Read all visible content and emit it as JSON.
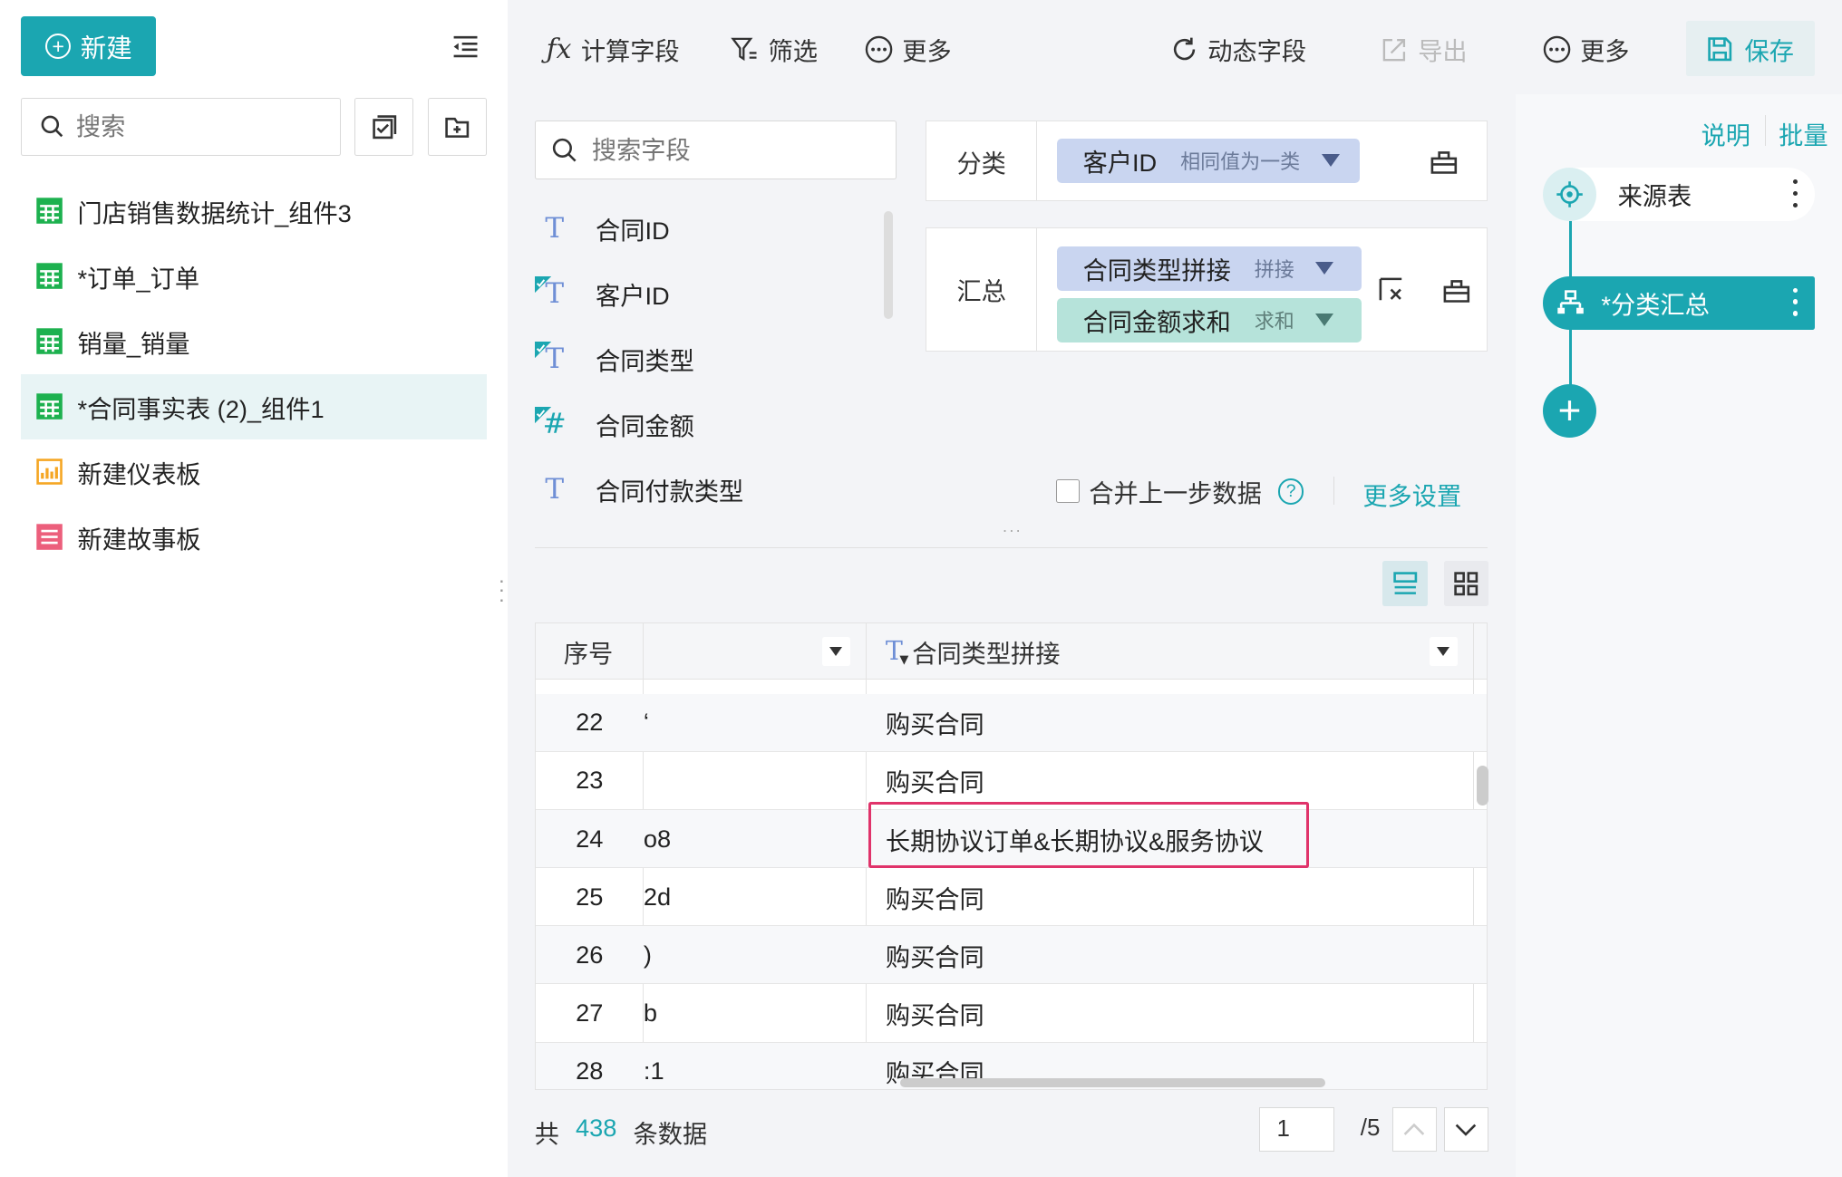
{
  "sidebar": {
    "new_label": "新建",
    "search_placeholder": "搜索",
    "items": [
      {
        "label": "门店销售数据统计_组件3",
        "type": "table"
      },
      {
        "label": "*订单_订单",
        "type": "table"
      },
      {
        "label": "销量_销量",
        "type": "table"
      },
      {
        "label": "*合同事实表 (2)_组件1",
        "type": "table",
        "active": true
      },
      {
        "label": "新建仪表板",
        "type": "dashboard"
      },
      {
        "label": "新建故事板",
        "type": "story"
      }
    ]
  },
  "toolbar": {
    "calc_field": "计算字段",
    "filter": "筛选",
    "more_left": "更多",
    "dynamic_field": "动态字段",
    "export": "导出",
    "more_right": "更多",
    "save": "保存"
  },
  "fields": {
    "search_placeholder": "搜索字段",
    "items": [
      {
        "label": "合同ID",
        "icon": "T"
      },
      {
        "label": "客户ID",
        "icon": "T",
        "checked": true
      },
      {
        "label": "合同类型",
        "icon": "T",
        "checked": true
      },
      {
        "label": "合同金额",
        "icon": "#",
        "checked": true
      },
      {
        "label": "合同付款类型",
        "icon": "T"
      }
    ]
  },
  "config": {
    "classify_label": "分类",
    "classify_pill": {
      "name": "客户ID",
      "sub": "相同值为一类"
    },
    "summary_label": "汇总",
    "summary_pills": [
      {
        "name": "合同类型拼接",
        "sub": "拼接"
      },
      {
        "name": "合同金额求和",
        "sub": "求和"
      }
    ],
    "merge_label": "合并上一步数据",
    "more_settings": "更多设置"
  },
  "table": {
    "col_index": "序号",
    "col_type": "合同类型拼接",
    "rows": [
      {
        "idx": "22",
        "id": "‘",
        "type": "购买合同"
      },
      {
        "idx": "23",
        "id": "",
        "type": "购买合同"
      },
      {
        "idx": "24",
        "id": "o8",
        "type": "长期协议订单&长期协议&服务协议"
      },
      {
        "idx": "25",
        "id": "2d",
        "type": "购买合同"
      },
      {
        "idx": "26",
        "id": ")",
        "type": "购买合同"
      },
      {
        "idx": "27",
        "id": "b",
        "type": "购买合同"
      },
      {
        "idx": "28",
        "id": ":1",
        "type": "购买合同"
      }
    ]
  },
  "footer": {
    "prefix": "共",
    "count": "438",
    "suffix": "条数据",
    "page": "1",
    "page_total": "/5"
  },
  "flow": {
    "explain": "说明",
    "batch": "批量",
    "source_node": "来源表",
    "sum_node": "*分类汇总"
  },
  "colors": {
    "accent": "#1ba6b1",
    "highlight": "#e0336a"
  }
}
